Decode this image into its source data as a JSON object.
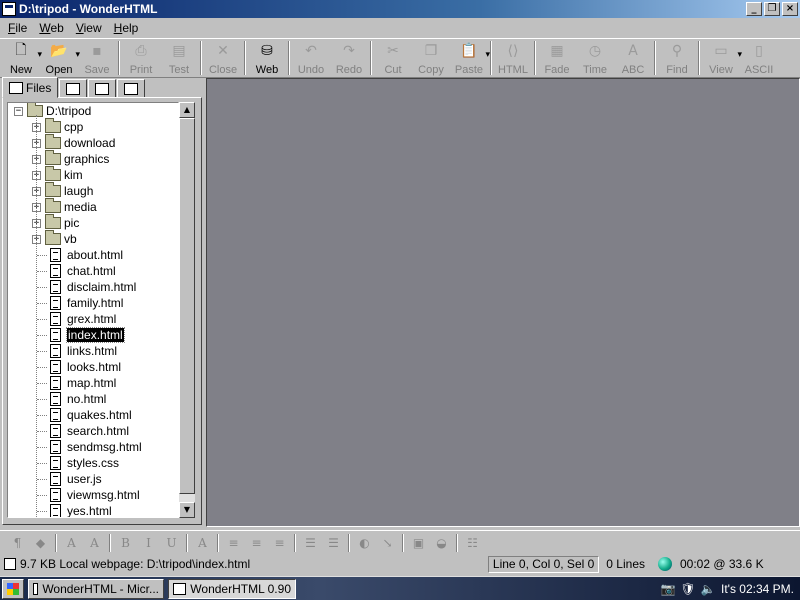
{
  "window": {
    "title": "D:\\tripod - WonderHTML"
  },
  "menu": [
    "File",
    "Web",
    "View",
    "Help"
  ],
  "toolbar": [
    {
      "label": "New",
      "icon": "new-file-icon",
      "glyph": "🗋",
      "enabled": true,
      "dropdown": true
    },
    {
      "label": "Open",
      "icon": "open-folder-icon",
      "glyph": "📂",
      "enabled": true,
      "dropdown": true
    },
    {
      "label": "Save",
      "icon": "save-icon",
      "glyph": "▪",
      "enabled": false
    },
    {
      "sep": true
    },
    {
      "label": "Print",
      "icon": "print-icon",
      "glyph": "⎙",
      "enabled": false
    },
    {
      "label": "Test",
      "icon": "test-icon",
      "glyph": "▤",
      "enabled": false
    },
    {
      "sep": true
    },
    {
      "label": "Close",
      "icon": "close-icon",
      "glyph": "✕",
      "enabled": false
    },
    {
      "sep": true
    },
    {
      "label": "Web",
      "icon": "web-icon",
      "glyph": "⛁",
      "enabled": true
    },
    {
      "sep": true
    },
    {
      "label": "Undo",
      "icon": "undo-icon",
      "glyph": "↶",
      "enabled": false
    },
    {
      "label": "Redo",
      "icon": "redo-icon",
      "glyph": "↷",
      "enabled": false
    },
    {
      "sep": true
    },
    {
      "label": "Cut",
      "icon": "cut-icon",
      "glyph": "✂",
      "enabled": false
    },
    {
      "label": "Copy",
      "icon": "copy-icon",
      "glyph": "❐",
      "enabled": false
    },
    {
      "label": "Paste",
      "icon": "paste-icon",
      "glyph": "📋",
      "enabled": false,
      "dropdown": true
    },
    {
      "sep": true
    },
    {
      "label": "HTML",
      "icon": "html-icon",
      "glyph": "⟨⟩",
      "enabled": false
    },
    {
      "sep": true
    },
    {
      "label": "Fade",
      "icon": "fade-icon",
      "glyph": "▦",
      "enabled": false
    },
    {
      "label": "Time",
      "icon": "time-icon",
      "glyph": "◷",
      "enabled": false
    },
    {
      "label": "ABC",
      "icon": "spell-check-icon",
      "glyph": "A",
      "enabled": false
    },
    {
      "sep": true
    },
    {
      "label": "Find",
      "icon": "find-icon",
      "glyph": "⚲",
      "enabled": false
    },
    {
      "sep": true
    },
    {
      "label": "View",
      "icon": "view-icon",
      "glyph": "▭",
      "enabled": false,
      "dropdown": true
    },
    {
      "label": "ASCII",
      "icon": "ascii-icon",
      "glyph": "▯",
      "enabled": false
    }
  ],
  "tabs": [
    {
      "label": "Files",
      "icon": "files-tab-icon",
      "active": true
    },
    {
      "label": "",
      "icon": "tab2-icon",
      "active": false
    },
    {
      "label": "",
      "icon": "tab3-icon",
      "active": false
    },
    {
      "label": "",
      "icon": "tab4-icon",
      "active": false
    }
  ],
  "tree": {
    "root": "D:\\tripod",
    "folders": [
      "cpp",
      "download",
      "graphics",
      "kim",
      "laugh",
      "media",
      "pic",
      "vb"
    ],
    "files": [
      "about.html",
      "chat.html",
      "disclaim.html",
      "family.html",
      "grex.html",
      "index.html",
      "links.html",
      "looks.html",
      "map.html",
      "no.html",
      "quakes.html",
      "search.html",
      "sendmsg.html",
      "styles.css",
      "user.js",
      "viewmsg.html",
      "yes.html"
    ],
    "selected": "index.html"
  },
  "format_toolbar": [
    "¶",
    "◆",
    "A",
    "A",
    "B",
    "I",
    "U",
    "A",
    "≡",
    "≡",
    "≡",
    "☰",
    "☰",
    "◐",
    "↘",
    "▣",
    "◒",
    "☷"
  ],
  "status": {
    "message": "9.7 KB Local webpage: D:\\tripod\\index.html",
    "position": "Line 0, Col 0, Sel 0",
    "lines": "0 Lines",
    "download": "00:02 @ 33.6 K"
  },
  "taskbar": {
    "tasks": [
      "WonderHTML - Micr...",
      "WonderHTML 0.90"
    ],
    "clock": "It's 02:34 PM."
  }
}
